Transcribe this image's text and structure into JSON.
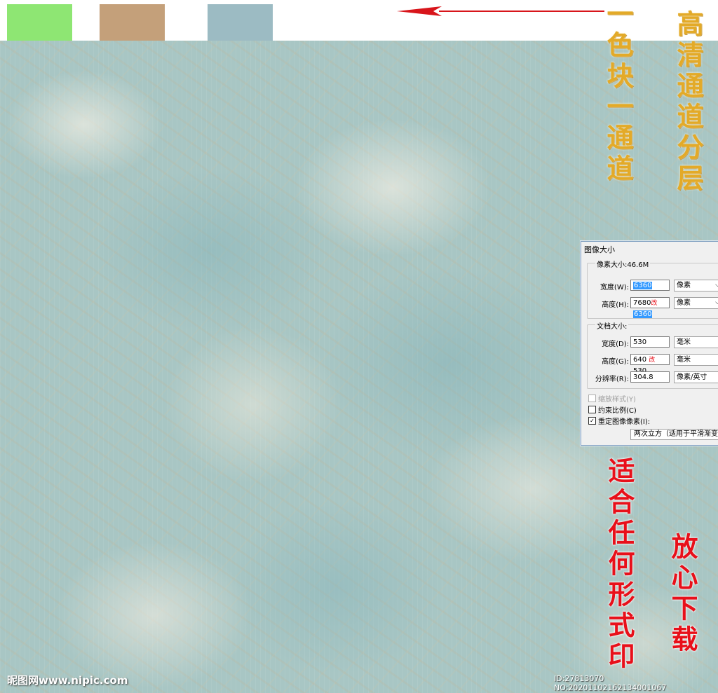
{
  "swatch_colors": [
    "#8ee673",
    "#c4a07a",
    "#9cbbc3"
  ],
  "annotations": {
    "gold_left": "一色块一通道",
    "gold_right": "高清通道分层",
    "red_left": "适合任何形式印",
    "red_right": "放心下载"
  },
  "dialog": {
    "title": "图像大小",
    "pixel_group_label": "像素大小:46.6M",
    "width_label": "宽度(W):",
    "width_value": "6360",
    "width_unit": "像素",
    "height_label": "高度(H):",
    "height_old": "7680",
    "height_value": "6360",
    "height_unit": "像素",
    "doc_group_label": "文档大小:",
    "doc_width_label": "宽度(D):",
    "doc_width_value": "530",
    "doc_width_unit": "毫米",
    "doc_height_label": "高度(G):",
    "doc_height_old": "640",
    "doc_height_value": "530",
    "doc_height_unit": "毫米",
    "resolution_label": "分辨率(R):",
    "resolution_value": "304.8",
    "resolution_unit": "像素/英寸",
    "scale_styles": "缩放样式(Y)",
    "constrain": "约束比例(C)",
    "resample": "重定图像像素(I):",
    "resample_method": "两次立方（适用于平滑渐变",
    "change_mark": "改"
  },
  "watermarks": {
    "left": "昵图网www.nipic.com",
    "right": "ID:27813070 NO:20201102162134001067"
  }
}
